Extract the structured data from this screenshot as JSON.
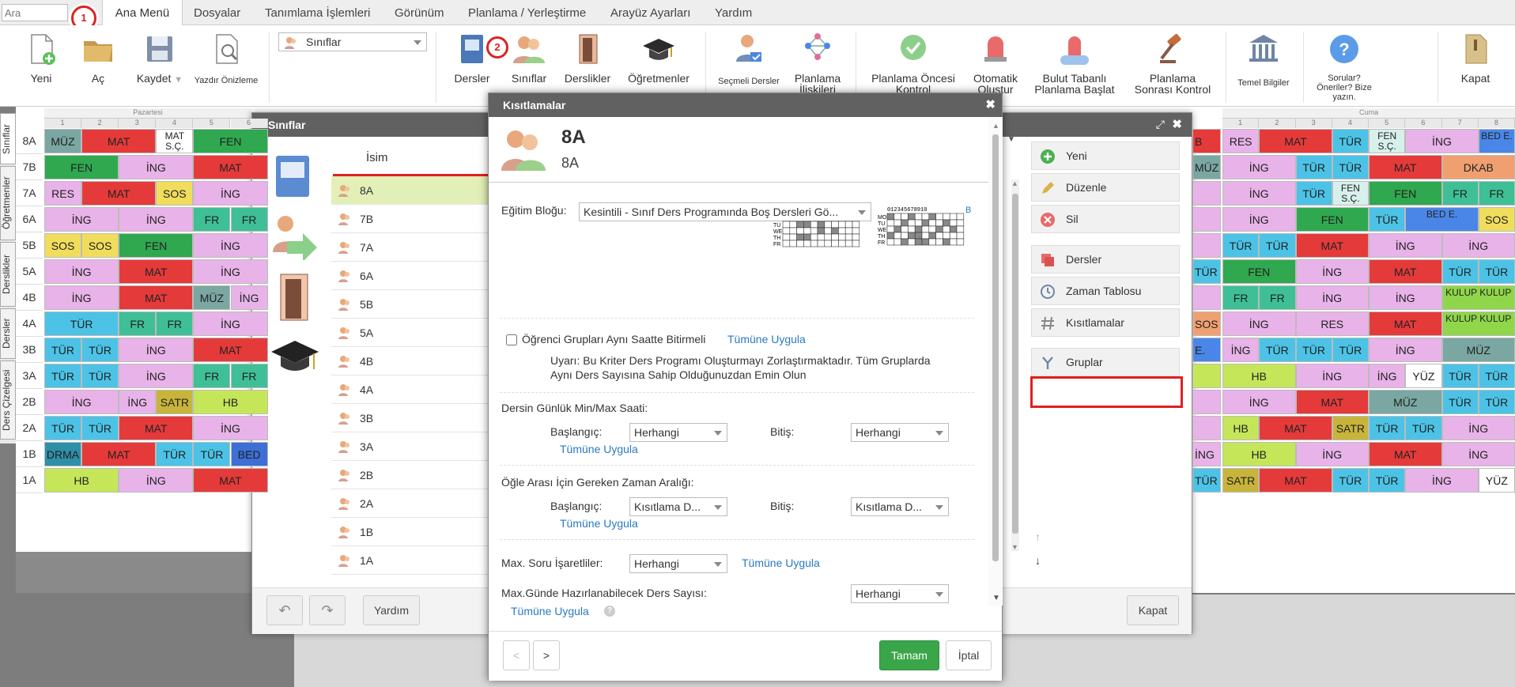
{
  "menubar": {
    "search_placeholder": "Ara",
    "tabs": [
      "Ana Menü",
      "Dosyalar",
      "Tanımlama İşlemleri",
      "Görünüm",
      "Planlama / Yerleştirme",
      "Arayüz Ayarları",
      "Yardım"
    ]
  },
  "badges": {
    "one": "1",
    "two": "2"
  },
  "ribbon": {
    "yeni": "Yeni",
    "ac": "Aç",
    "kaydet": "Kaydet",
    "yazdir": "Yazdır Önizleme",
    "sinif_select": "Sınıflar",
    "dersler": "Dersler",
    "siniflar": "Sınıflar",
    "derslikler": "Derslikler",
    "ogretmenler": "Öğretmenler",
    "secmeli": "Seçmeli Dersler",
    "planlama_iliskileri_1": "Planlama",
    "planlama_iliskileri_2": "İlişkileri",
    "oncesi_1": "Planlama Öncesi",
    "oncesi_2": "Kontrol",
    "otomatik_1": "Otomatik",
    "otomatik_2": "Oluştur",
    "bulut_1": "Bulut Tabanlı",
    "bulut_2": "Planlama Başlat",
    "sonrasi_1": "Planlama",
    "sonrasi_2": "Sonrası Kontrol",
    "temel": "Temel Bilgiler",
    "sorular_1": "Sorular?",
    "sorular_2": "Öneriler? Bize",
    "sorular_3": "yazın.",
    "kapat": "Kapat"
  },
  "vtabs": [
    "Sınıflar",
    "Öğretmenler",
    "Derslikler",
    "Dersler",
    "Ders Çizelgesi"
  ],
  "timetable": {
    "day_left": "Pazartesi",
    "day_right": "Cuma",
    "periods_left": [
      "1",
      "2",
      "3",
      "4",
      "5",
      "6"
    ],
    "periods_right": [
      "1",
      "2",
      "3",
      "4",
      "5",
      "6",
      "7",
      "8"
    ],
    "rows": [
      "8A",
      "7B",
      "7A",
      "6A",
      "5B",
      "5A",
      "4B",
      "4A",
      "3B",
      "3A",
      "2B",
      "2A",
      "1B",
      "1A"
    ],
    "left_cells": [
      [
        [
          "MÜZ",
          1,
          "#7aa7a1"
        ],
        [
          "MAT",
          2,
          "#e53a3a"
        ],
        [
          "MAT S.Ç.",
          1,
          "#ffffff"
        ],
        [
          "FEN",
          2,
          "#2fa84f"
        ]
      ],
      [
        [
          "FEN",
          2,
          "#2fa84f"
        ],
        [
          "İNG",
          2,
          "#e8b3e8"
        ],
        [
          "MAT",
          2,
          "#e53a3a"
        ]
      ],
      [
        [
          "RES",
          1,
          "#e8b3e8"
        ],
        [
          "MAT",
          2,
          "#e53a3a"
        ],
        [
          "SOS",
          1,
          "#f1dd5c"
        ],
        [
          "İNG",
          2,
          "#e8b3e8"
        ]
      ],
      [
        [
          "İNG",
          2,
          "#e8b3e8"
        ],
        [
          "İNG",
          2,
          "#e8b3e8"
        ],
        [
          "FR",
          1,
          "#3fbf95"
        ],
        [
          "FR",
          1,
          "#3fbf95"
        ]
      ],
      [
        [
          "SOS",
          1,
          "#f1dd5c"
        ],
        [
          "SOS",
          1,
          "#f1dd5c"
        ],
        [
          "FEN",
          2,
          "#2fa84f"
        ],
        [
          "İNG",
          2,
          "#e8b3e8"
        ]
      ],
      [
        [
          "İNG",
          2,
          "#e8b3e8"
        ],
        [
          "MAT",
          2,
          "#e53a3a"
        ],
        [
          "İNG",
          2,
          "#e8b3e8"
        ]
      ],
      [
        [
          "İNG",
          2,
          "#e8b3e8"
        ],
        [
          "MAT",
          2,
          "#e53a3a"
        ],
        [
          "MÜZ",
          1,
          "#7aa7a1"
        ],
        [
          "İNG",
          1,
          "#e8b3e8"
        ]
      ],
      [
        [
          "TÜR",
          2,
          "#4cc3e6"
        ],
        [
          "FR",
          1,
          "#3fbf95"
        ],
        [
          "FR",
          1,
          "#3fbf95"
        ],
        [
          "İNG",
          2,
          "#e8b3e8"
        ]
      ],
      [
        [
          "TÜR",
          1,
          "#4cc3e6"
        ],
        [
          "TÜR",
          1,
          "#4cc3e6"
        ],
        [
          "İNG",
          2,
          "#e8b3e8"
        ],
        [
          "MAT",
          2,
          "#e53a3a"
        ]
      ],
      [
        [
          "TÜR",
          1,
          "#4cc3e6"
        ],
        [
          "TÜR",
          1,
          "#4cc3e6"
        ],
        [
          "İNG",
          2,
          "#e8b3e8"
        ],
        [
          "FR",
          1,
          "#3fbf95"
        ],
        [
          "FR",
          1,
          "#3fbf95"
        ]
      ],
      [
        [
          "İNG",
          2,
          "#e8b3e8"
        ],
        [
          "İNG",
          1,
          "#e8b3e8"
        ],
        [
          "SATR",
          1,
          "#c8b43a"
        ],
        [
          "HB",
          2,
          "#c6e65a"
        ]
      ],
      [
        [
          "TÜR",
          1,
          "#4cc3e6"
        ],
        [
          "TÜR",
          1,
          "#4cc3e6"
        ],
        [
          "MAT",
          2,
          "#e53a3a"
        ],
        [
          "İNG",
          2,
          "#e8b3e8"
        ]
      ],
      [
        [
          "DRMA",
          1,
          "#2e8fa8"
        ],
        [
          "MAT",
          2,
          "#e53a3a"
        ],
        [
          "TÜR",
          1,
          "#4cc3e6"
        ],
        [
          "TÜR",
          1,
          "#4cc3e6"
        ],
        [
          "BED",
          1,
          "#3d6fd6"
        ]
      ],
      [
        [
          "HB",
          2,
          "#c6e65a"
        ],
        [
          "İNG",
          2,
          "#e8b3e8"
        ],
        [
          "MAT",
          2,
          "#e53a3a"
        ]
      ]
    ],
    "right_cells": [
      [
        [
          "RES",
          1,
          "#e8b3e8"
        ],
        [
          "MAT",
          2,
          "#e53a3a"
        ],
        [
          "TÜR",
          1,
          "#4cc3e6"
        ],
        [
          "FEN S.Ç.",
          1,
          "#d7f0ec"
        ],
        [
          "İNG",
          2,
          "#e8b3e8"
        ],
        [
          "BED E.",
          1,
          "#4a86e8"
        ]
      ],
      [
        [
          "İNG",
          2,
          "#e8b3e8"
        ],
        [
          "TÜR",
          1,
          "#4cc3e6"
        ],
        [
          "TÜR",
          1,
          "#4cc3e6"
        ],
        [
          "MAT",
          2,
          "#e53a3a"
        ],
        [
          "DKAB",
          2,
          "#f0a070"
        ]
      ],
      [
        [
          "İNG",
          2,
          "#e8b3e8"
        ],
        [
          "TÜR",
          1,
          "#4cc3e6"
        ],
        [
          "FEN S.Ç.",
          1,
          "#d7f0ec"
        ],
        [
          "FEN",
          2,
          "#2fa84f"
        ],
        [
          "FR",
          1,
          "#3fbf95"
        ],
        [
          "FR",
          1,
          "#3fbf95"
        ]
      ],
      [
        [
          "İNG",
          2,
          "#e8b3e8"
        ],
        [
          "FEN",
          2,
          "#2fa84f"
        ],
        [
          "TÜR",
          1,
          "#4cc3e6"
        ],
        [
          "BED E.",
          2,
          "#4a86e8"
        ],
        [
          "SOS",
          1,
          "#f1dd5c"
        ]
      ],
      [
        [
          "TÜR",
          1,
          "#4cc3e6"
        ],
        [
          "TÜR",
          1,
          "#4cc3e6"
        ],
        [
          "MAT",
          2,
          "#e53a3a"
        ],
        [
          "İNG",
          2,
          "#e8b3e8"
        ],
        [
          "İNG",
          2,
          "#e8b3e8"
        ]
      ],
      [
        [
          "FEN",
          2,
          "#2fa84f"
        ],
        [
          "İNG",
          2,
          "#e8b3e8"
        ],
        [
          "MAT",
          2,
          "#e53a3a"
        ],
        [
          "TÜR",
          1,
          "#4cc3e6"
        ],
        [
          "TÜR",
          1,
          "#4cc3e6"
        ]
      ],
      [
        [
          "FR",
          1,
          "#3fbf95"
        ],
        [
          "FR",
          1,
          "#3fbf95"
        ],
        [
          "İNG",
          2,
          "#e8b3e8"
        ],
        [
          "İNG",
          2,
          "#e8b3e8"
        ],
        [
          "KULUP KULUP",
          2,
          "#8fd64a"
        ]
      ],
      [
        [
          "İNG",
          2,
          "#e8b3e8"
        ],
        [
          "RES",
          2,
          "#e8b3e8"
        ],
        [
          "MAT",
          2,
          "#e53a3a"
        ],
        [
          "KULUP KULUP",
          2,
          "#8fd64a"
        ]
      ],
      [
        [
          "İNG",
          1,
          "#e8b3e8"
        ],
        [
          "TÜR",
          1,
          "#4cc3e6"
        ],
        [
          "TÜR",
          1,
          "#4cc3e6"
        ],
        [
          "TÜR",
          1,
          "#4cc3e6"
        ],
        [
          "İNG",
          2,
          "#e8b3e8"
        ],
        [
          "MÜZ",
          2,
          "#7aa7a1"
        ]
      ],
      [
        [
          "HB",
          2,
          "#c6e65a"
        ],
        [
          "İNG",
          2,
          "#e8b3e8"
        ],
        [
          "İNG",
          1,
          "#e8b3e8"
        ],
        [
          "YÜZ",
          1,
          "#ffffff"
        ],
        [
          "TÜR",
          1,
          "#4cc3e6"
        ],
        [
          "TÜR",
          1,
          "#4cc3e6"
        ]
      ],
      [
        [
          "İNG",
          2,
          "#e8b3e8"
        ],
        [
          "MAT",
          2,
          "#e53a3a"
        ],
        [
          "MÜZ",
          2,
          "#7aa7a1"
        ],
        [
          "TÜR",
          1,
          "#4cc3e6"
        ],
        [
          "TÜR",
          1,
          "#4cc3e6"
        ]
      ],
      [
        [
          "HB",
          1,
          "#c6e65a"
        ],
        [
          "MAT",
          2,
          "#e53a3a"
        ],
        [
          "SATR",
          1,
          "#c8b43a"
        ],
        [
          "TÜR",
          1,
          "#4cc3e6"
        ],
        [
          "TÜR",
          1,
          "#4cc3e6"
        ],
        [
          "İNG",
          2,
          "#e8b3e8"
        ]
      ],
      [
        [
          "HB",
          2,
          "#c6e65a"
        ],
        [
          "İNG",
          2,
          "#e8b3e8"
        ],
        [
          "MAT",
          2,
          "#e53a3a"
        ],
        [
          "İNG",
          2,
          "#e8b3e8"
        ]
      ],
      [
        [
          "SATR",
          1,
          "#c8b43a"
        ],
        [
          "MAT",
          2,
          "#e53a3a"
        ],
        [
          "TÜR",
          1,
          "#4cc3e6"
        ],
        [
          "TÜR",
          1,
          "#4cc3e6"
        ],
        [
          "İNG",
          2,
          "#e8b3e8"
        ],
        [
          "YÜZ",
          1,
          "#ffffff"
        ]
      ]
    ],
    "partial_left": [
      "B",
      "MÜZ",
      "",
      "",
      "",
      "TÜR",
      "",
      "SOS",
      "E.",
      "",
      "",
      "",
      "İNG",
      "TÜR"
    ],
    "partial_colors": [
      "#e53a3a",
      "#7aa7a1",
      "#e8b3e8",
      "#e8b3e8",
      "#e8b3e8",
      "#4cc3e6",
      "#e8b3e8",
      "#f0a070",
      "#4a86e8",
      "#c6e65a",
      "#e8b3e8",
      "#e8b3e8",
      "#e8b3e8",
      "#4cc3e6"
    ]
  },
  "siniflar_dialog": {
    "title": "Sınıflar",
    "col_header": "İsim",
    "items": [
      "8A",
      "7B",
      "7A",
      "6A",
      "5B",
      "5A",
      "4B",
      "4A",
      "3B",
      "3A",
      "2B",
      "2A",
      "1B",
      "1A"
    ],
    "buttons": [
      "Yeni",
      "Düzenle",
      "Sil",
      "Dersler",
      "Zaman Tablosu",
      "Kısıtlamalar",
      "Gruplar"
    ],
    "yardim": "Yardım",
    "kapat": "Kapat"
  },
  "kisit_dialog": {
    "title": "Kısıtlamalar",
    "name_big": "8A",
    "name_small": "8A",
    "egitim_label": "Eğitim Bloğu:",
    "egitim_value": "Kesintili - Sınıf Ders Programında Boş Dersleri Gö...",
    "grid_days": [
      "MO",
      "TU",
      "WE",
      "TH",
      "FR"
    ],
    "grid_nums": "012345678910",
    "grid_partial_link": "B",
    "checkbox_label": "Öğrenci Grupları Aynı Saatte Bitirmeli",
    "tumune": "Tümüne Uygula",
    "warn_1": "Uyarı: Bu Kriter Ders Programı Oluşturmayı Zorlaştırmaktadır. Tüm Gruplarda",
    "warn_2": "Aynı Ders Sayısına Sahip Olduğunuzdan Emin Olun",
    "gunluk_title": "Dersin Günlük Min/Max Saati:",
    "baslangic": "Başlangıç:",
    "bitis": "Bitiş:",
    "herhangi": "Herhangi",
    "ogle_title": "Öğle Arası İçin Gereken Zaman Aralığı:",
    "kisitlama_d": "Kısıtlama D...",
    "max_soru": "Max. Soru İşaretliler:",
    "max_gunde": "Max.Günde Hazırlanabilecek Ders Sayısı:",
    "tamam": "Tamam",
    "iptal": "İptal",
    "prev": "<",
    "next": ">"
  },
  "colors": {
    "highlight_red": "#e02020",
    "ok_green": "#3aa64a",
    "link_blue": "#2a79c4",
    "header_gray": "#616161"
  }
}
